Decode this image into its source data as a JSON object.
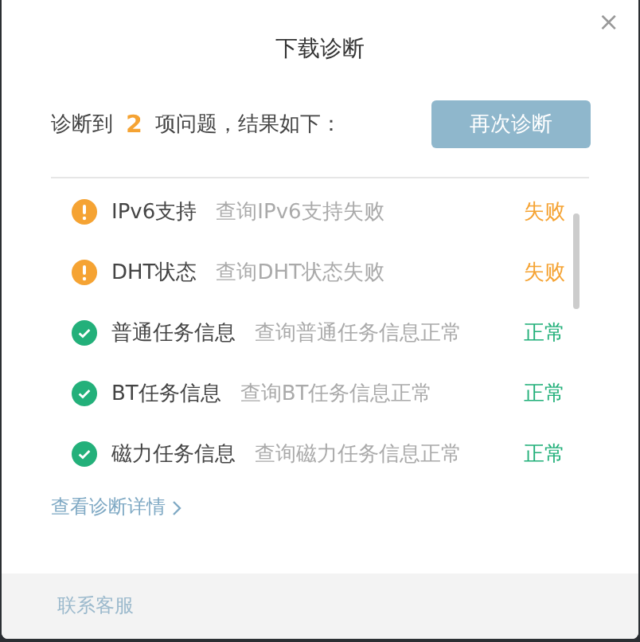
{
  "dialog": {
    "title": "下载诊断",
    "close": "×"
  },
  "summary": {
    "prefix": "诊断到",
    "count": "2",
    "suffix": "项问题，结果如下：",
    "button": "再次诊断"
  },
  "items": [
    {
      "kind": "warning",
      "name": "IPv6支持",
      "detail": "查询IPv6支持失败",
      "status": "失败"
    },
    {
      "kind": "warning",
      "name": "DHT状态",
      "detail": "查询DHT状态失败",
      "status": "失败"
    },
    {
      "kind": "success",
      "name": "普通任务信息",
      "detail": "查询普通任务信息正常",
      "status": "正常"
    },
    {
      "kind": "success",
      "name": "BT任务信息",
      "detail": "查询BT任务信息正常",
      "status": "正常"
    },
    {
      "kind": "success",
      "name": "磁力任务信息",
      "detail": "查询磁力任务信息正常",
      "status": "正常"
    }
  ],
  "details_link": "查看诊断详情",
  "footer": {
    "link": "联系客服"
  }
}
